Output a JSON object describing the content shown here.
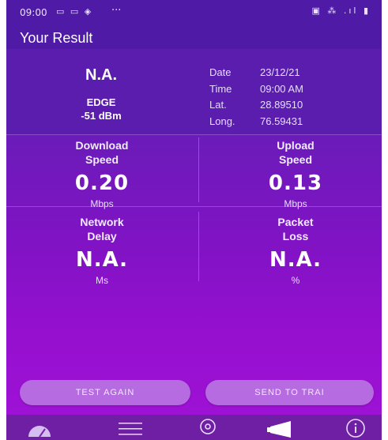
{
  "status_bar": {
    "time": "09:00",
    "left_icons": "▭ ▭ ◈",
    "dots": "···",
    "right_icons": "▣ ⁂ .ıl ▮"
  },
  "header": {
    "title": "Your Result"
  },
  "result": {
    "operator": "N.A.",
    "technology": "EDGE",
    "signal": "-51 dBm",
    "info": [
      {
        "label": "Date",
        "value": "23/12/21"
      },
      {
        "label": "Time",
        "value": "09:00 AM"
      },
      {
        "label": "Lat.",
        "value": "28.89510"
      },
      {
        "label": "Long.",
        "value": "76.59431"
      }
    ]
  },
  "metrics": {
    "download": {
      "title_line1": "Download",
      "title_line2": "Speed",
      "value": "0.20",
      "unit": "Mbps"
    },
    "upload": {
      "title_line1": "Upload",
      "title_line2": "Speed",
      "value": "0.13",
      "unit": "Mbps"
    },
    "delay": {
      "title_line1": "Network",
      "title_line2": "Delay",
      "value": "N.A.",
      "unit": "Ms"
    },
    "loss": {
      "title_line1": "Packet",
      "title_line2": "Loss",
      "value": "N.A.",
      "unit": "%"
    }
  },
  "buttons": {
    "test_again": "TEST AGAIN",
    "send_to_trai": "SEND TO TRAI"
  },
  "bottom_nav": {
    "items": [
      {
        "icon": "speedometer-icon"
      },
      {
        "icon": "list-icon"
      },
      {
        "icon": "location-pin-icon"
      },
      {
        "icon": "megaphone-icon"
      },
      {
        "icon": "info-icon"
      }
    ]
  },
  "colors": {
    "header_bg": "#4f1aa6",
    "gradient_top": "#5f1fb5",
    "gradient_bottom": "#a012d6",
    "button_bg": "#b66be0",
    "nav_bg": "#6e1fa3"
  }
}
